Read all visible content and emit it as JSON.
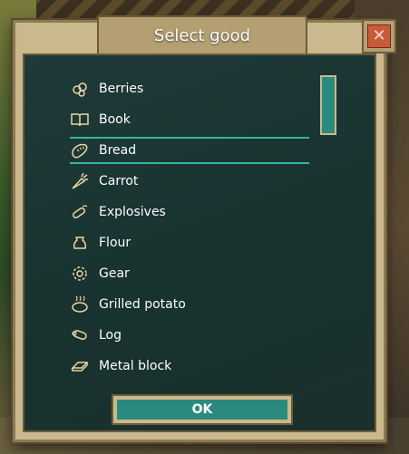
{
  "dialog": {
    "title": "Select good",
    "ok_label": "OK",
    "close_glyph": "✕"
  },
  "goods": [
    {
      "label": "Berries",
      "icon": "berries-icon",
      "selected": false
    },
    {
      "label": "Book",
      "icon": "book-icon",
      "selected": false
    },
    {
      "label": "Bread",
      "icon": "bread-icon",
      "selected": true
    },
    {
      "label": "Carrot",
      "icon": "carrot-icon",
      "selected": false
    },
    {
      "label": "Explosives",
      "icon": "explosives-icon",
      "selected": false
    },
    {
      "label": "Flour",
      "icon": "flour-icon",
      "selected": false
    },
    {
      "label": "Gear",
      "icon": "gear-icon",
      "selected": false
    },
    {
      "label": "Grilled potato",
      "icon": "grilled-potato-icon",
      "selected": false
    },
    {
      "label": "Log",
      "icon": "log-icon",
      "selected": false
    },
    {
      "label": "Metal block",
      "icon": "metal-block-icon",
      "selected": false
    }
  ],
  "colors": {
    "accent": "#36b6a6",
    "button": "#2b8a7e",
    "frame": "#c9b98d",
    "panel": "#1b332f",
    "icon": "#e9d6a4"
  }
}
